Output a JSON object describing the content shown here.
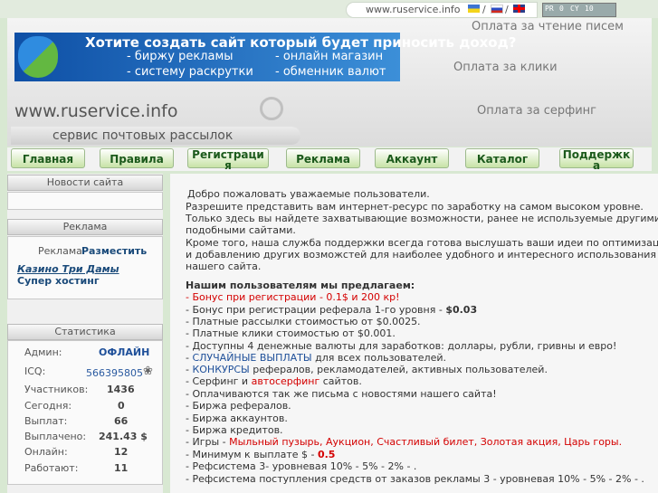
{
  "topbar": {
    "url": "www.ruservice.info",
    "sep": "/",
    "pr_label": "PR",
    "pr_value": "0",
    "cy_label": "CY",
    "cy_value": "10"
  },
  "banner": {
    "title": "Хотите создать сайт который будет приносить доход?",
    "line1_left": "- биржу рекламы",
    "line1_right": "- онлайн магазин",
    "line2_left": "- систему раскрутки",
    "line2_right": "- обменник валют"
  },
  "header_menu": [
    "Оплата за чтение писем",
    "Оплата за клики",
    "Оплата за серфинг"
  ],
  "site_url": "www.ruservice.info",
  "slogan": "сервис почтовых рассылок",
  "nav": [
    {
      "label": "Главная"
    },
    {
      "label": "Правила"
    },
    {
      "label": "Регистраци\nя"
    },
    {
      "label": "Реклама"
    },
    {
      "label": "Аккаунт"
    },
    {
      "label": "Каталог"
    },
    {
      "label": "Поддержк\nа"
    }
  ],
  "sidebar": {
    "news_title": "Новости сайта",
    "ads_title": "Реклама",
    "ads_label": "Реклама",
    "ads_place": "Разместить",
    "ads_casino": "Казино Три Дамы",
    "ads_hosting": "Супер хостинг",
    "stats_title": "Статистика",
    "stats": [
      {
        "label": "Админ:",
        "value": "ОФЛАЙН"
      },
      {
        "label": "ICQ:",
        "value": "566395805"
      },
      {
        "label": "Участников:",
        "value": "1436"
      },
      {
        "label": "Сегодня:",
        "value": "0"
      },
      {
        "label": "Выплат:",
        "value": "66"
      },
      {
        "label": "Выплачено:",
        "value": "241.43 $"
      },
      {
        "label": "Онлайн:",
        "value": "12"
      },
      {
        "label": "Работают:",
        "value": "11"
      }
    ]
  },
  "content": {
    "intro": [
      "Добро пожаловать уважаемые пользователи.",
      "Разрешите представить вам интернет-ресурс по заработку на самом высоком уровне.",
      "Только здесь вы найдете захватывающие возможности, ранее не используемые другими",
      "подобными сайтами.",
      "Кроме того, наша служба поддержки всегда готова выслушать ваши идеи по оптимизации",
      "и добавлению других возможстей для наиболее удобного и интересного использования",
      "нашего сайта."
    ],
    "offers_title": "Нашим пользователям мы предлагаем:",
    "offer1": "- Бонус при регистрации - 0.1$ и 200 кр!",
    "offer2_a": "- Бонус при регистрации реферала 1-го уровня - ",
    "offer2_b": "$0.03",
    "offer3": "- Платные рассылки стоимостью от $0.0025.",
    "offer4": "- Платные клики стоимостью от $0.001.",
    "offer5": "- Доступны 4 денежные валюты для заработков: доллары, рубли, гривны и евро!",
    "offer6_a": "- ",
    "offer6_b": "СЛУЧАЙНЫЕ ВЫПЛАТЫ",
    "offer6_c": " для всех пользователей.",
    "offer7_a": "- ",
    "offer7_b": "КОНКУРСЫ",
    "offer7_c": " рефералов, рекламодателей, активных пользователей.",
    "offer8_a": "- Серфинг и ",
    "offer8_b": "автосерфинг",
    "offer8_c": " сайтов.",
    "offer9": "- Оплачиваются так же письма с новостями нашего сайта!",
    "offer10": "- Биржа рефералов.",
    "offer11": "- Биржа аккаунтов.",
    "offer12": "- Биржа кредитов.",
    "offer13_a": "- Игры - ",
    "offer13_b": "Мыльный пузырь, Аукцион, Счастливый билет, Золотая акция, Царь горы.",
    "offer14_a": "- Минимум к выплате $ - ",
    "offer14_b": "0.5",
    "offer15": "- Рефсистема 3- уровневая 10% - 5% - 2% - .",
    "offer16": "- Рефсистема поступления средств от заказов рекламы 3 - уровневая 10% - 5% - 2% - ."
  }
}
